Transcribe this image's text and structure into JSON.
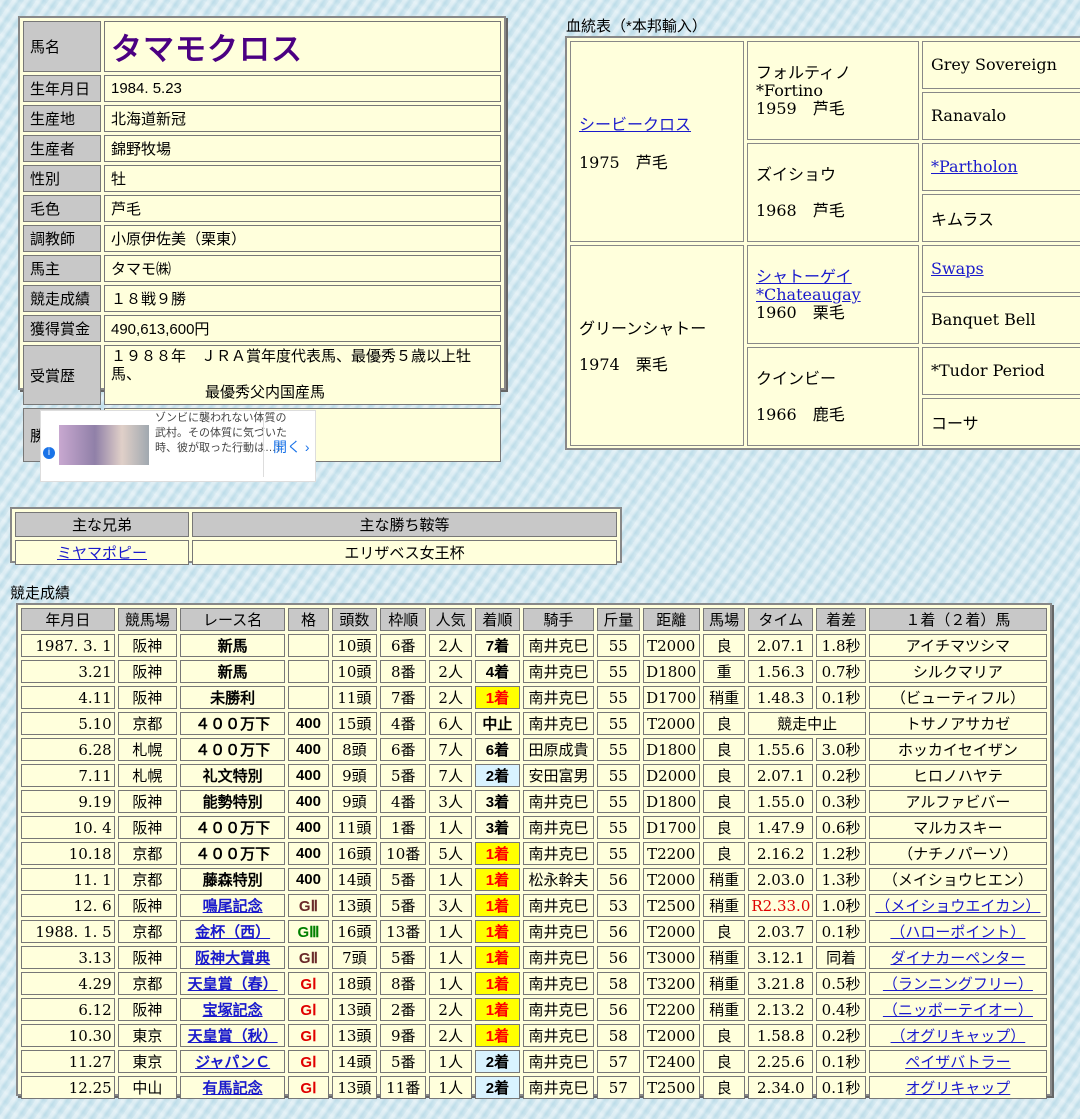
{
  "profile": {
    "name_label": "馬名",
    "name": "タマモクロス",
    "rows": [
      {
        "k": "生年月日",
        "v": "1984. 5.23"
      },
      {
        "k": "生産地",
        "v": "北海道新冠"
      },
      {
        "k": "生産者",
        "v": "錦野牧場"
      },
      {
        "k": "性別",
        "v": "牡"
      },
      {
        "k": "毛色",
        "v": "芦毛"
      },
      {
        "k": "調教師",
        "v": "小原伊佐美（栗東）"
      },
      {
        "k": "馬主",
        "v": "タマモ㈱"
      },
      {
        "k": "競走成績",
        "v": "１８戦９勝"
      },
      {
        "k": "獲得賞金",
        "v": "490,613,600円"
      }
    ],
    "awards_label": "受賞歴",
    "awards_line1": "１９８８年　ＪＲＡ賞年度代表馬、最優秀５歳以上牡馬、",
    "awards_line2": "最優秀父内国産馬",
    "silks_label": "勝負服",
    "silks_colors": {
      "body": "#e03030",
      "stripe": "#20b0c0"
    }
  },
  "pedigree": {
    "title": "血統表（*本邦輸入）",
    "sire": {
      "name": "シービークロス",
      "info": "1975　芦毛"
    },
    "dam": {
      "name": "グリーンシャトー",
      "info": "1974　栗毛"
    },
    "ss": {
      "name": "フォルティノ",
      "name2": "*Fortino",
      "info": "1959　芦毛"
    },
    "sd": {
      "name": "ズイショウ",
      "info": "1968　芦毛"
    },
    "ds": {
      "name": "シャトーゲイ",
      "name2": "*Chateaugay",
      "info": "1960　栗毛"
    },
    "dd": {
      "name": "クインビー",
      "info": "1966　鹿毛"
    },
    "g": [
      "Grey Sovereign",
      "Ranavalo",
      "*Partholon",
      "キムラス",
      "Swaps",
      "Banquet Bell",
      "*Tudor Period",
      "コーサ"
    ]
  },
  "ad": {
    "text": "ゾンビに襲われない体質の武村。その体質に気づいた時、彼が取った行動は…！",
    "open": "開く",
    "info": "i"
  },
  "siblings": {
    "headers": [
      "主な兄弟",
      "主な勝ち鞍等"
    ],
    "rows": [
      [
        "ミヤマポピー",
        "エリザベス女王杯"
      ]
    ]
  },
  "races": {
    "title": "競走成績",
    "headers": [
      "年月日",
      "競馬場",
      "レース名",
      "格",
      "頭数",
      "枠順",
      "人気",
      "着順",
      "騎手",
      "斤量",
      "距離",
      "馬場",
      "タイム",
      "着差",
      "１着（２着）馬"
    ],
    "rows": [
      [
        "1987. 3. 1",
        "阪神",
        "新馬",
        "",
        "10頭",
        "6番",
        "2人",
        "7着",
        "南井克巳",
        "55",
        "T2000",
        "良",
        "2.07.1",
        "1.8秒",
        "アイチマツシマ"
      ],
      [
        "3.21",
        "阪神",
        "新馬",
        "",
        "10頭",
        "8番",
        "2人",
        "4着",
        "南井克巳",
        "55",
        "D1800",
        "重",
        "1.56.3",
        "0.7秒",
        "シルクマリア"
      ],
      [
        "4.11",
        "阪神",
        "未勝利",
        "",
        "11頭",
        "7番",
        "2人",
        "1着",
        "南井克巳",
        "55",
        "D1700",
        "稍重",
        "1.48.3",
        "0.1秒",
        "（ビューティフル）"
      ],
      [
        "5.10",
        "京都",
        "４００万下",
        "400",
        "15頭",
        "4番",
        "6人",
        "中止",
        "南井克巳",
        "55",
        "T2000",
        "良",
        "競走中止",
        "",
        "トサノアサカゼ"
      ],
      [
        "6.28",
        "札幌",
        "４００万下",
        "400",
        "8頭",
        "6番",
        "7人",
        "6着",
        "田原成貴",
        "55",
        "D1800",
        "良",
        "1.55.6",
        "3.0秒",
        "ホッカイセイザン"
      ],
      [
        "7.11",
        "札幌",
        "礼文特別",
        "400",
        "9頭",
        "5番",
        "7人",
        "2着",
        "安田富男",
        "55",
        "D2000",
        "良",
        "2.07.1",
        "0.2秒",
        "ヒロノハヤテ"
      ],
      [
        "9.19",
        "阪神",
        "能勢特別",
        "400",
        "9頭",
        "4番",
        "3人",
        "3着",
        "南井克巳",
        "55",
        "D1800",
        "良",
        "1.55.0",
        "0.3秒",
        "アルファビバー"
      ],
      [
        "10. 4",
        "阪神",
        "４００万下",
        "400",
        "11頭",
        "1番",
        "1人",
        "3着",
        "南井克巳",
        "55",
        "D1700",
        "良",
        "1.47.9",
        "0.6秒",
        "マルカスキー"
      ],
      [
        "10.18",
        "京都",
        "４００万下",
        "400",
        "16頭",
        "10番",
        "5人",
        "1着",
        "南井克巳",
        "55",
        "T2200",
        "良",
        "2.16.2",
        "1.2秒",
        "（ナチノパーソ）"
      ],
      [
        "11. 1",
        "京都",
        "藤森特別",
        "400",
        "14頭",
        "5番",
        "1人",
        "1着",
        "松永幹夫",
        "56",
        "T2000",
        "稍重",
        "2.03.0",
        "1.3秒",
        "（メイショウヒエン）"
      ],
      [
        "12. 6",
        "阪神",
        "鳴尾記念",
        "GII",
        "13頭",
        "5番",
        "3人",
        "1着",
        "南井克巳",
        "53",
        "T2500",
        "稍重",
        "R2.33.0",
        "1.0秒",
        "（メイショウエイカン）"
      ],
      [
        "1988. 1. 5",
        "京都",
        "金杯（西）",
        "GIII",
        "16頭",
        "13番",
        "1人",
        "1着",
        "南井克巳",
        "56",
        "T2000",
        "良",
        "2.03.7",
        "0.1秒",
        "（ハローポイント）"
      ],
      [
        "3.13",
        "阪神",
        "阪神大賞典",
        "GII",
        "7頭",
        "5番",
        "1人",
        "1着",
        "南井克巳",
        "56",
        "T3000",
        "稍重",
        "3.12.1",
        "同着",
        "ダイナカーペンター"
      ],
      [
        "4.29",
        "京都",
        "天皇賞（春）",
        "GI",
        "18頭",
        "8番",
        "1人",
        "1着",
        "南井克巳",
        "58",
        "T3200",
        "稍重",
        "3.21.8",
        "0.5秒",
        "（ランニングフリー）"
      ],
      [
        "6.12",
        "阪神",
        "宝塚記念",
        "GI",
        "13頭",
        "2番",
        "2人",
        "1着",
        "南井克巳",
        "56",
        "T2200",
        "稍重",
        "2.13.2",
        "0.4秒",
        "（ニッポーテイオー）"
      ],
      [
        "10.30",
        "東京",
        "天皇賞（秋）",
        "GI",
        "13頭",
        "9番",
        "2人",
        "1着",
        "南井克巳",
        "58",
        "T2000",
        "良",
        "1.58.8",
        "0.2秒",
        "（オグリキャップ）"
      ],
      [
        "11.27",
        "東京",
        "ジャパンＣ",
        "GI",
        "14頭",
        "5番",
        "1人",
        "2着",
        "南井克巳",
        "57",
        "T2400",
        "良",
        "2.25.6",
        "0.1秒",
        "ペイザバトラー"
      ],
      [
        "12.25",
        "中山",
        "有馬記念",
        "GI",
        "13頭",
        "11番",
        "1人",
        "2着",
        "南井克巳",
        "57",
        "T2500",
        "良",
        "2.34.0",
        "0.1秒",
        "オグリキャップ"
      ]
    ]
  }
}
